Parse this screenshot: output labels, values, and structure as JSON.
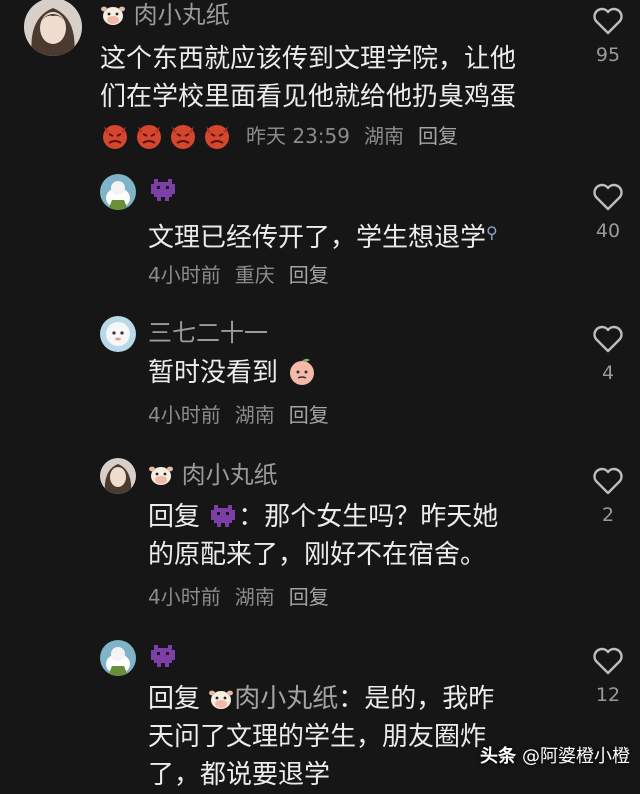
{
  "comments": [
    {
      "name": "肉小丸纸",
      "text_line1": "这个东西就应该传到文理学院，让他",
      "text_line2": "们在学校里面看见他就给他扔臭鸡蛋",
      "time": "昨天 23:59",
      "location": "湖南",
      "reply": "回复",
      "likes": "95"
    },
    {
      "name": "",
      "text": "文理已经传开了，学生想退学",
      "time": "4小时前",
      "location": "重庆",
      "reply": "回复",
      "likes": "40"
    },
    {
      "name": "三七二十一",
      "text": "暂时没看到",
      "time": "4小时前",
      "location": "湖南",
      "reply": "回复",
      "likes": "4"
    },
    {
      "name": "肉小丸纸",
      "reply_prefix": "回复",
      "colon_text": "：那个女生吗？昨天她",
      "text_line2": "的原配来了，刚好不在宿舍。",
      "time": "4小时前",
      "location": "湖南",
      "reply": "回复",
      "likes": "2"
    },
    {
      "name": "",
      "reply_prefix": "回复",
      "mention": "肉小丸纸",
      "colon_text": "：是的，我昨",
      "text_line2": "天问了文理的学生，朋友圈炸",
      "text_line3": "了，都说要退学",
      "likes": "12"
    }
  ],
  "watermark": {
    "logo": "头条",
    "text": "@阿婆橙小橙"
  },
  "colors": {
    "background": "#161616",
    "text": "#ececec",
    "secondary": "#8b8b8b",
    "mention": "#8fa6c4"
  }
}
